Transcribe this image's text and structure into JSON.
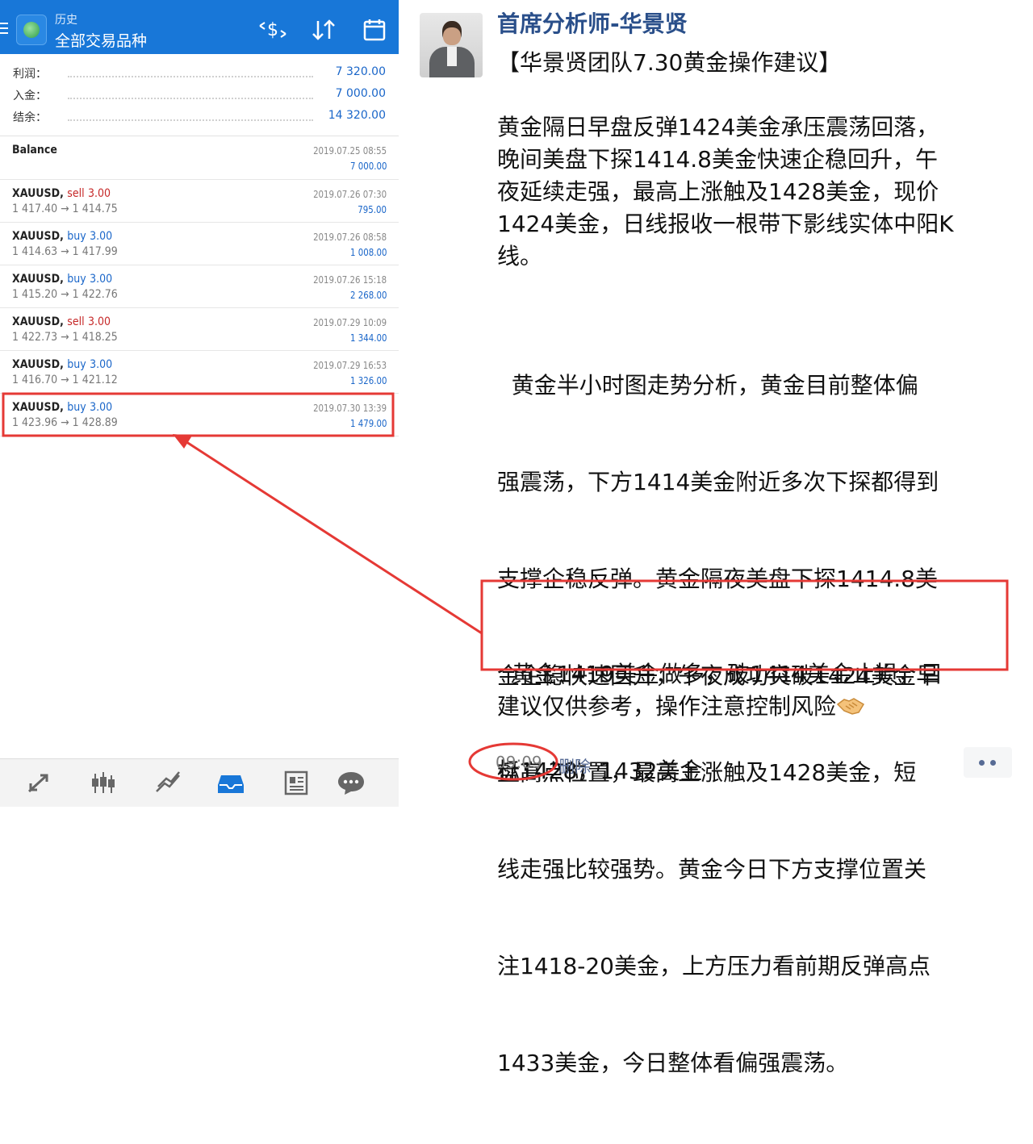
{
  "mt4": {
    "header": {
      "title": "历史",
      "subtitle": "全部交易品种"
    },
    "toolbar_icons": [
      "currency-filter-icon",
      "sort-icon",
      "calendar-icon"
    ],
    "summary": [
      {
        "label": "利润：",
        "value": "7 320.00"
      },
      {
        "label": "入金：",
        "value": "7 000.00"
      },
      {
        "label": "结余：",
        "value": "14 320.00"
      }
    ],
    "balance": {
      "label": "Balance",
      "date": "2019.07.25 08:55",
      "amount": "7 000.00"
    },
    "trades": [
      {
        "symbol": "XAUUSD,",
        "side": "sell",
        "lots": "3.00",
        "prices": "1 417.40 → 1 414.75",
        "date": "2019.07.26 07:30",
        "profit": "795.00"
      },
      {
        "symbol": "XAUUSD,",
        "side": "buy",
        "lots": "3.00",
        "prices": "1 414.63 → 1 417.99",
        "date": "2019.07.26 08:58",
        "profit": "1 008.00"
      },
      {
        "symbol": "XAUUSD,",
        "side": "buy",
        "lots": "3.00",
        "prices": "1 415.20 → 1 422.76",
        "date": "2019.07.26 15:18",
        "profit": "2 268.00"
      },
      {
        "symbol": "XAUUSD,",
        "side": "sell",
        "lots": "3.00",
        "prices": "1 422.73 → 1 418.25",
        "date": "2019.07.29 10:09",
        "profit": "1 344.00"
      },
      {
        "symbol": "XAUUSD,",
        "side": "buy",
        "lots": "3.00",
        "prices": "1 416.70 → 1 421.12",
        "date": "2019.07.29 16:53",
        "profit": "1 326.00"
      },
      {
        "symbol": "XAUUSD,",
        "side": "buy",
        "lots": "3.00",
        "prices": "1 423.96 → 1 428.89",
        "date": "2019.07.30 13:39",
        "profit": "1 479.00"
      }
    ],
    "bottom_nav": [
      "trade-icon",
      "chart-icon",
      "analytics-icon",
      "inbox-icon",
      "news-icon",
      "chat-icon"
    ],
    "colors": {
      "header": "#1877d8",
      "sell": "#c62828",
      "buy": "#1a66c9"
    }
  },
  "post": {
    "author": "首席分析师-华景贤",
    "title": "【华景贤团队7.30黄金操作建议】",
    "para1": [
      "黄金隔日早盘反弹1424美金承压震荡回落，",
      "晚间美盘下探1414.8美金快速企稳回升，午",
      "夜延续走强，最高上涨触及1428美金，现价",
      "1424美金，日线报收一根带下影线实体中阳K",
      "线。"
    ],
    "para2": [
      "  黄金半小时图走势分析，黄金目前整体偏",
      "强震荡，下方1414美金附近多次下探都得到",
      "支撑企稳反弹。黄金隔夜美盘下探1414.8美",
      "金企稳快速回升，午夜成功突破1424美金早",
      "盘高点位置，最高上涨触及1428美金，短",
      "线走强比较强势。黄金今日下方支撑位置关",
      "注1418-20美金，上方压力看前期反弹高点",
      "1433美金，今日整体看偏强震荡。"
    ],
    "para3": [
      "  黄金1419美金做多，破1414美金止损，目",
      "标1428，1432美金"
    ],
    "disclaimer": "建议仅供参考，操作注意控制风险",
    "time": "09:09",
    "delete_label": "删除",
    "highlight_color": "#e53935"
  }
}
